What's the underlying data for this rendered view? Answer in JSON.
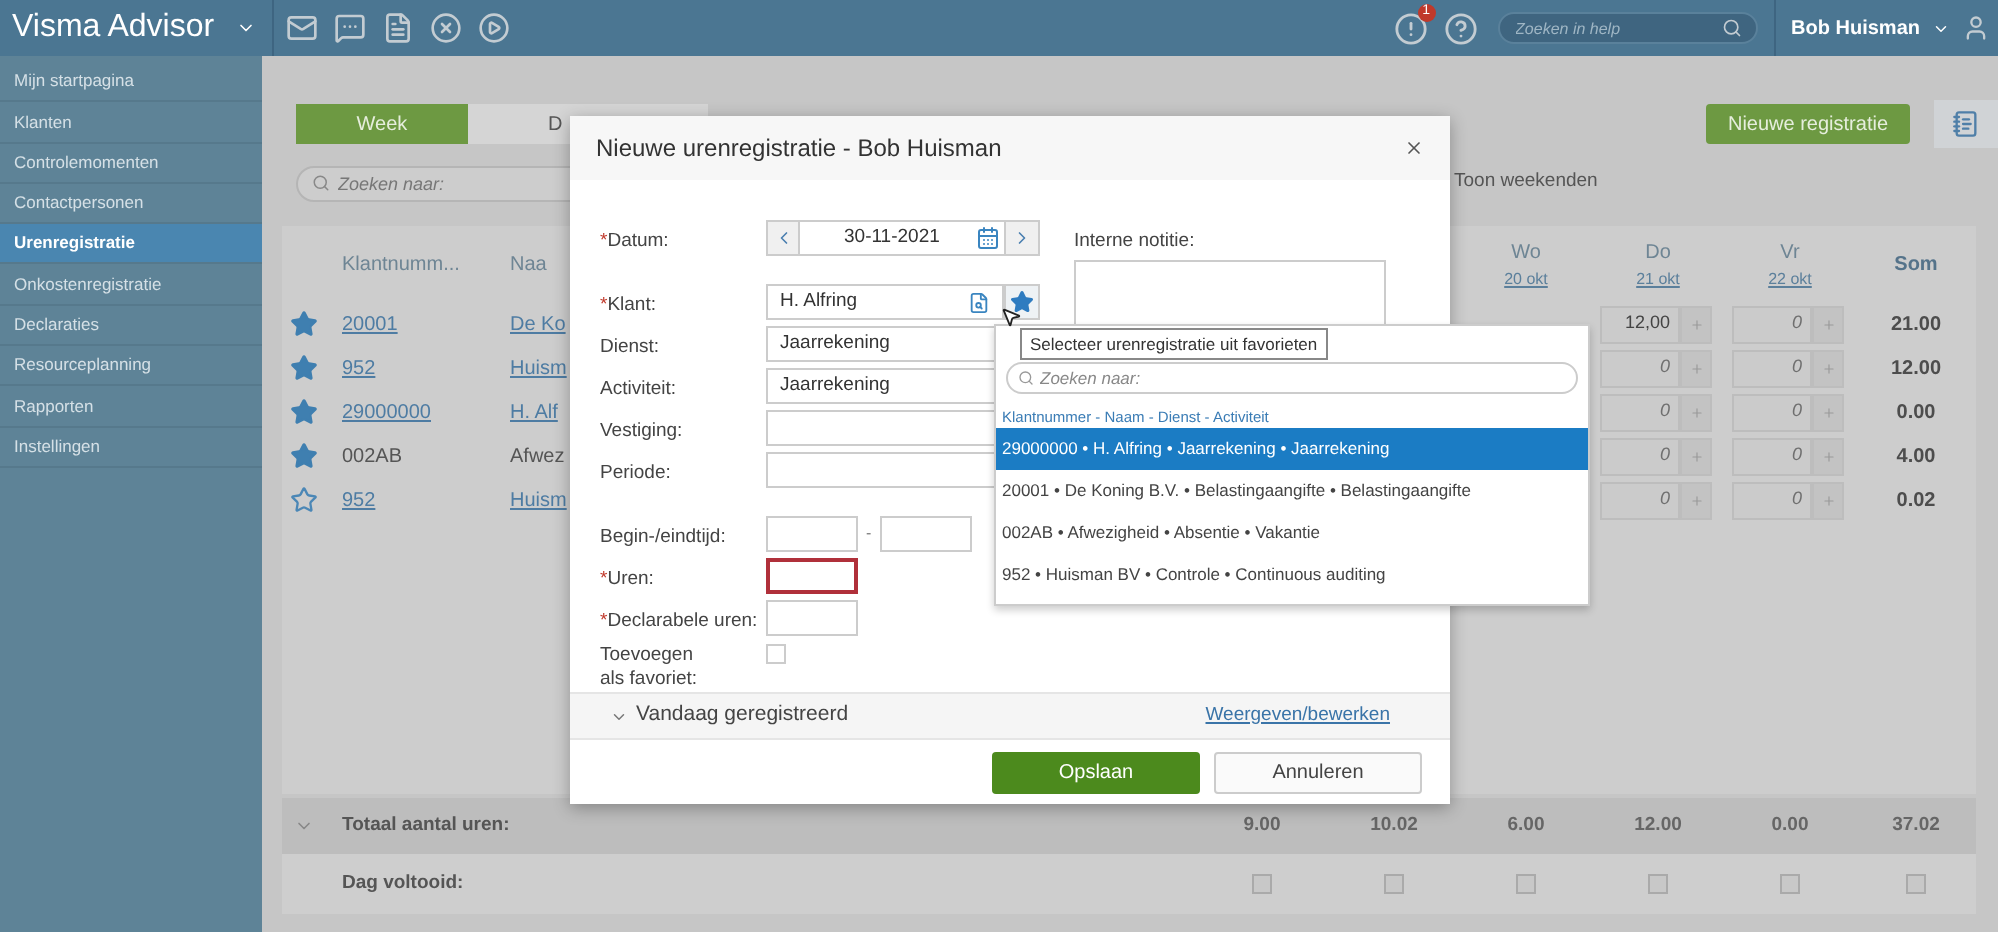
{
  "header": {
    "logo": "Visma Advisor",
    "alert_count": "1",
    "search": {
      "placeholder": "Zoeken in help"
    },
    "user": "Bob Huisman"
  },
  "sidebar": {
    "items": [
      {
        "label": "Mijn startpagina",
        "selected": false
      },
      {
        "label": "Klanten",
        "selected": false
      },
      {
        "label": "Controlemomenten",
        "selected": false
      },
      {
        "label": "Contactpersonen",
        "selected": false
      },
      {
        "label": "Urenregistratie",
        "selected": true
      },
      {
        "label": "Onkostenregistratie",
        "selected": false
      },
      {
        "label": "Declaraties",
        "selected": false
      },
      {
        "label": "Resourceplanning",
        "selected": false
      },
      {
        "label": "Rapporten",
        "selected": false
      },
      {
        "label": "Instellingen",
        "selected": false
      }
    ]
  },
  "view_tabs": [
    {
      "label": "Week",
      "selected": true
    },
    {
      "label": "D",
      "selected": false
    }
  ],
  "search": {
    "placeholder": "Zoeken naar:"
  },
  "new_button": "Nieuwe registratie",
  "show_weekends": "Toon weekenden",
  "table": {
    "columns": {
      "number": "Klantnumm...",
      "name": "Naa",
      "days": [
        {
          "day": "Wo",
          "date": "20 okt"
        },
        {
          "day": "Do",
          "date": "21 okt"
        },
        {
          "day": "Vr",
          "date": "22 okt"
        }
      ],
      "sum": "Som"
    },
    "rows": [
      {
        "favorite": true,
        "link": true,
        "number": "20001",
        "name": "De Ko",
        "cells": [
          {
            "value": "12,00",
            "kind": "filled"
          },
          {
            "value": "0",
            "kind": "empty"
          }
        ],
        "sum": "21.00"
      },
      {
        "favorite": true,
        "link": true,
        "number": "952",
        "name": "Huism",
        "cells": [
          {
            "value": "0",
            "kind": "empty"
          },
          {
            "value": "0",
            "kind": "empty"
          }
        ],
        "sum": "12.00"
      },
      {
        "favorite": true,
        "link": true,
        "number": "29000000",
        "name": "H. Alf",
        "cells": [
          {
            "value": "0",
            "kind": "empty"
          },
          {
            "value": "0",
            "kind": "empty"
          }
        ],
        "sum": "0.00"
      },
      {
        "favorite": true,
        "link": false,
        "number": "002AB",
        "name": "Afwez",
        "cells": [
          {
            "value": "0",
            "kind": "empty"
          },
          {
            "value": "0",
            "kind": "empty"
          }
        ],
        "sum": "4.00"
      },
      {
        "favorite": false,
        "link": true,
        "number": "952",
        "name": "Huism",
        "cells": [
          {
            "value": "0",
            "kind": "empty"
          },
          {
            "value": "0",
            "kind": "empty"
          }
        ],
        "sum": "0.02"
      }
    ],
    "totals": {
      "label": "Totaal aantal uren:",
      "expanded": false,
      "values": [
        "9.00",
        "10.02",
        "6.00",
        "12.00",
        "0.00",
        "37.02"
      ]
    },
    "day_done": {
      "label": "Dag voltooid:",
      "checks": [
        false,
        false,
        false,
        false,
        false,
        false
      ]
    }
  },
  "dialog": {
    "title": "Nieuwe urenregistratie - Bob Huisman",
    "date": {
      "mark": "*",
      "label": "Datum:",
      "value": "30-11-2021"
    },
    "client": {
      "mark": "*",
      "label": "Klant:",
      "value": "H. Alfring"
    },
    "fields": [
      {
        "label": "Dienst:",
        "value": "Jaarrekening"
      },
      {
        "label": "Activiteit:",
        "value": "Jaarrekening"
      },
      {
        "label": "Vestiging:"
      },
      {
        "label": "Periode:"
      }
    ],
    "time": {
      "label": "Begin-/eindtijd:",
      "separator": "-"
    },
    "hours": {
      "mark": "*",
      "label": "Uren:",
      "error": true
    },
    "billable": {
      "mark": "*",
      "label": "Declarabele uren:",
      "error": false
    },
    "favorite": {
      "label": "Toevoegen als favoriet:",
      "checked": false
    },
    "note": {
      "label": "Interne notitie:"
    },
    "today": {
      "label": "Vandaag geregistreerd",
      "expanded": false,
      "link": "Weergeven/bewerken"
    },
    "buttons": [
      {
        "label": "Opslaan",
        "kind": "primary"
      },
      {
        "label": "Annuleren",
        "kind": "secondary"
      }
    ]
  },
  "tooltip": "Selecteer urenregistratie uit favorieten",
  "favorites": {
    "search": {
      "placeholder": "Zoeken naar:"
    },
    "heading": "Klantnummer - Naam - Dienst - Activiteit",
    "items": [
      {
        "label": "29000000 • H. Alfring • Jaarrekening • Jaarrekening",
        "selected": true
      },
      {
        "label": "20001 • De Koning B.V. • Belastingaangifte • Belastingaangifte",
        "selected": false
      },
      {
        "label": "002AB • Afwezigheid • Absentie • Vakantie",
        "selected": false
      },
      {
        "label": "952 • Huisman BV • Controle • Continuous auditing",
        "selected": false
      }
    ]
  }
}
